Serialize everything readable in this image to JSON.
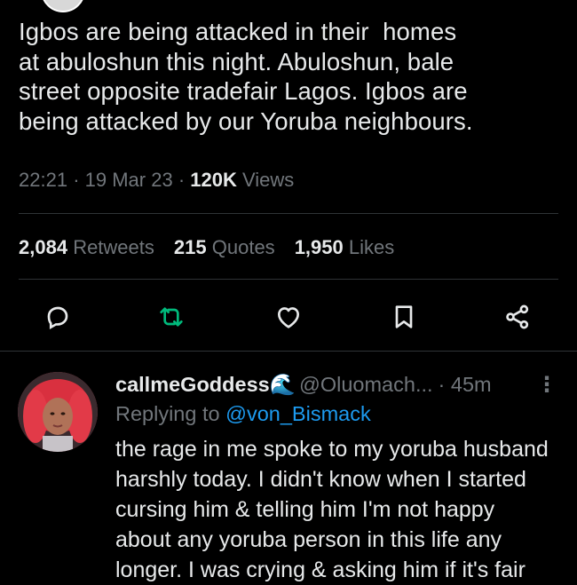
{
  "tweet": {
    "text": "Igbos are being attacked in their  homes\nat abuloshun this night. Abuloshun, bale\nstreet opposite tradefair Lagos. Igbos are\nbeing attacked by our Yoruba neighbours.",
    "time": "22:21",
    "date": "19 Mar 23",
    "views_count": "120K",
    "views_label": "Views"
  },
  "stats": {
    "retweets_count": "2,084",
    "retweets_label": "Retweets",
    "quotes_count": "215",
    "quotes_label": "Quotes",
    "likes_count": "1,950",
    "likes_label": "Likes"
  },
  "actions": {
    "icons": [
      "reply-icon",
      "retweet-icon",
      "like-icon",
      "bookmark-icon",
      "share-icon"
    ],
    "retweet_color": "#00ba7c",
    "icon_color": "#e7e9ea"
  },
  "reply": {
    "name": "callmeGoddess",
    "name_emoji": "🌊",
    "handle": "@Oluomach...",
    "time": "45m",
    "more": "⋮",
    "replying_prefix": "Replying to",
    "replying_to": "@von_Bismack",
    "lines": [
      "the rage in me spoke to my yoruba husband",
      "harshly today. I didn't know when I started",
      "cursing him & telling him I'm not happy",
      "about any yoruba person in this life any",
      "longer. I was crying & asking him if it's fair"
    ]
  },
  "colors": {
    "background": "#000000",
    "text": "#e7e9ea",
    "muted": "#71767b",
    "link": "#1d9bf0",
    "divider": "#2f3336"
  }
}
